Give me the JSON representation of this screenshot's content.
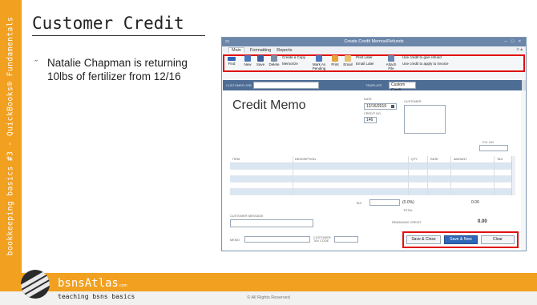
{
  "sidebar": {
    "text": "bookkeeping basics #3 - QuickBooks® Fundamentals"
  },
  "slide": {
    "title": "Customer Credit",
    "bullet_mark": "˝",
    "bullet": "Natalie Chapman is returning 10lbs of fertilizer from 12/16"
  },
  "window": {
    "title": "Create Credit Memos/Refunds",
    "left_icon": "▭",
    "controls": "– □ ×",
    "menu_tabs": [
      "Main",
      "Formatting",
      "Reports"
    ],
    "menu_controls": "≡ ▴"
  },
  "toolbar": {
    "find": "Find",
    "new": "New",
    "save": "Save",
    "delete": "Delete",
    "create_copy": "Create a Copy",
    "memorize": "Memorize",
    "mark_pending": "Mark As Pending",
    "print": "Print",
    "email": "Email",
    "print_later": "Print Later",
    "email_later": "Email Later",
    "attach_file": "Attach File",
    "use_credit_refund": "Use credit to give refund",
    "use_credit_invoice": "Use credit to apply to invoice"
  },
  "customer_bar": {
    "customer_job_label": "CUSTOMER:JOB",
    "customer_job_value": "",
    "template_label": "TEMPLATE",
    "template_value": "Custom Credi..."
  },
  "form": {
    "title": "Credit Memo",
    "date_label": "DATE",
    "date_value": "12/15/2019",
    "credit_no_label": "CREDIT NO.",
    "credit_no_value": "146",
    "customer_label": "CUSTOMER",
    "po_label": "P.O. NO.",
    "columns": [
      "ITEM",
      "DESCRIPTION",
      "QTY",
      "RATE",
      "AMOUNT",
      "TAX"
    ],
    "tax_label": "TAX",
    "tax_rate": "(0.0%)",
    "tax_amount": "0.00",
    "total_label": "TOTAL",
    "customer_message_label": "CUSTOMER MESSAGE",
    "remaining_label": "REMAINING CREDIT",
    "remaining_value": "0.00",
    "memo_label": "MEMO",
    "tax_code_label": "CUSTOMER TAX CODE"
  },
  "buttons": {
    "save_close": "Save & Close",
    "save_new": "Save & New",
    "clear": "Clear"
  },
  "footer": {
    "brand": "bsnsAtlas",
    "brand_sup": ".com",
    "tagline": "teaching bsns basics",
    "copyright": "© All Rights Reserved"
  },
  "colors": {
    "accent_orange": "#f2a020",
    "window_title": "#6c86aa",
    "customer_bar": "#4e6d95",
    "highlight_red": "#e01010",
    "primary_button": "#2f66b7"
  }
}
